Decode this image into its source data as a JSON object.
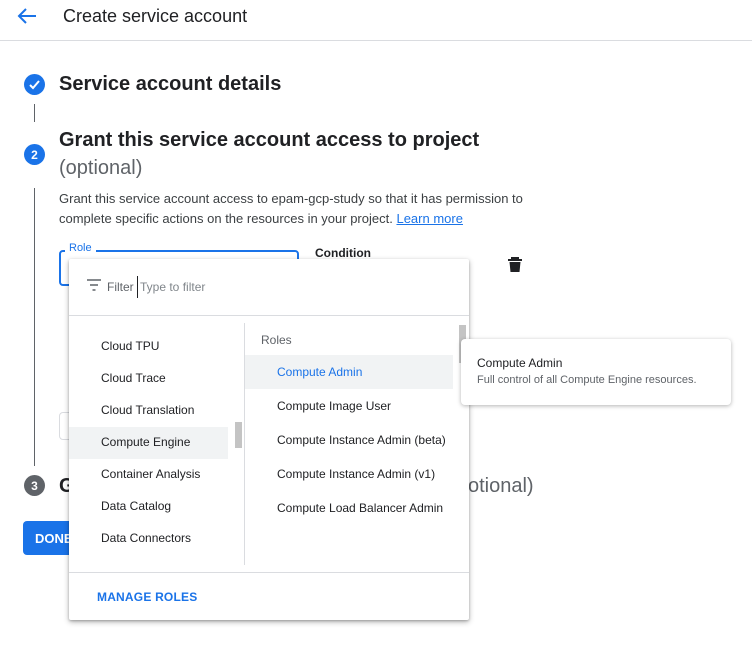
{
  "header": {
    "title": "Create service account",
    "back_icon": "arrow-back-icon"
  },
  "colors": {
    "accent": "#1a73e8",
    "inactive_step": "#5f6368"
  },
  "steps": [
    {
      "number": "1",
      "title": "Service account details",
      "status": "complete",
      "icon": "check-icon"
    },
    {
      "number": "2",
      "title": "Grant this service account access to project",
      "subtitle": "(optional)",
      "description": "Grant this service account access to epam-gcp-study so that it has permission to complete specific actions on the resources in your project.",
      "link": "Learn more"
    },
    {
      "number": "3",
      "title_left": "G",
      "title_right": "otional)"
    }
  ],
  "role_field": {
    "label": "Role"
  },
  "condition": {
    "label": "Condition"
  },
  "delete_icon": "trash-icon",
  "done_button": {
    "label": "DONE"
  },
  "dropdown": {
    "filter_icon": "filter-icon",
    "filter_label": "Filter",
    "filter_placeholder": "Type to filter",
    "services": [
      "Cloud TPU",
      "Cloud Trace",
      "Cloud Translation",
      "Compute Engine",
      "Container Analysis",
      "Data Catalog",
      "Data Connectors"
    ],
    "selected_service": "Compute Engine",
    "roles_heading": "Roles",
    "roles": [
      "Compute Admin",
      "Compute Image User",
      "Compute Instance Admin (beta)",
      "Compute Instance Admin (v1)",
      "Compute Load Balancer Admin"
    ],
    "selected_role": "Compute Admin",
    "manage_roles": "MANAGE ROLES"
  },
  "tooltip": {
    "title": "Compute Admin",
    "description": "Full control of all Compute Engine resources."
  }
}
